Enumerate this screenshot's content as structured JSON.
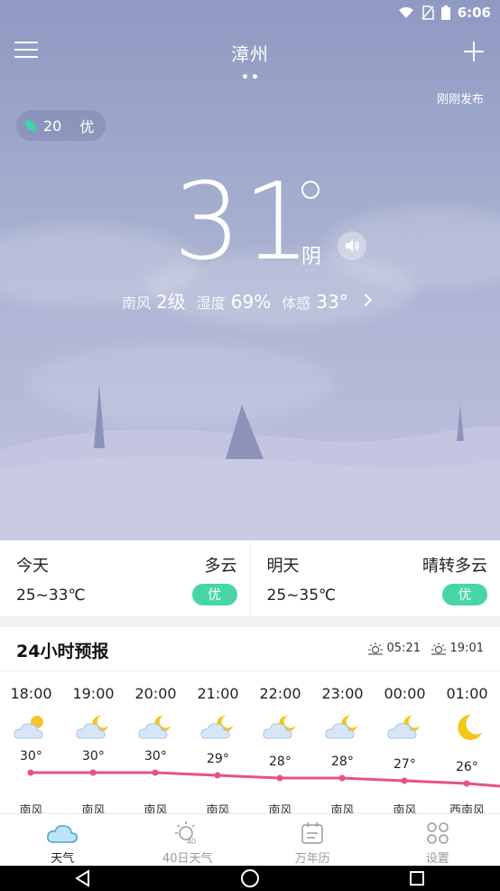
{
  "status_bar": {
    "time": "6:06",
    "icons": [
      "wifi-icon",
      "no-sim-icon",
      "battery-icon"
    ]
  },
  "header": {
    "city": "漳州",
    "publish": "刚刚发布"
  },
  "aqi": {
    "value": "20",
    "level": "优"
  },
  "current": {
    "temp": "31",
    "condition": "阴",
    "wind_label": "南风",
    "wind_value": "2级",
    "humidity_label": "湿度",
    "humidity_value": "69%",
    "feels_label": "体感",
    "feels_value": "33°"
  },
  "daily": [
    {
      "name": "今天",
      "condition": "多云",
      "range": "25~33℃",
      "aqi": "优"
    },
    {
      "name": "明天",
      "condition": "晴转多云",
      "range": "25~35℃",
      "aqi": "优"
    }
  ],
  "hourly": {
    "title": "24小时预报",
    "sunrise": "05:21",
    "sunset": "19:01",
    "hours": [
      {
        "time": "18:00",
        "icon": "sun-cloud-icon",
        "temp": "30°",
        "temp_value": 30,
        "wind": "南风"
      },
      {
        "time": "19:00",
        "icon": "moon-cloud-icon",
        "temp": "30°",
        "temp_value": 30,
        "wind": "南风"
      },
      {
        "time": "20:00",
        "icon": "moon-cloud-icon",
        "temp": "30°",
        "temp_value": 30,
        "wind": "南风"
      },
      {
        "time": "21:00",
        "icon": "moon-cloud-icon",
        "temp": "29°",
        "temp_value": 29,
        "wind": "南风"
      },
      {
        "time": "22:00",
        "icon": "moon-cloud-icon",
        "temp": "28°",
        "temp_value": 28,
        "wind": "南风"
      },
      {
        "time": "23:00",
        "icon": "moon-cloud-icon",
        "temp": "28°",
        "temp_value": 28,
        "wind": "南风"
      },
      {
        "time": "00:00",
        "icon": "moon-cloud-icon",
        "temp": "27°",
        "temp_value": 27,
        "wind": "南风"
      },
      {
        "time": "01:00",
        "icon": "moon-icon",
        "temp": "26°",
        "temp_value": 26,
        "wind": "西南风"
      }
    ]
  },
  "tabs": [
    {
      "label": "天气",
      "icon": "cloud-icon",
      "active": true
    },
    {
      "label": "40日天气",
      "icon": "sun-40-icon",
      "active": false
    },
    {
      "label": "万年历",
      "icon": "calendar-icon",
      "active": false
    },
    {
      "label": "设置",
      "icon": "settings-grid-icon",
      "active": false
    }
  ],
  "colors": {
    "accent": "#46d6a4",
    "temp_line": "#e8508a"
  }
}
